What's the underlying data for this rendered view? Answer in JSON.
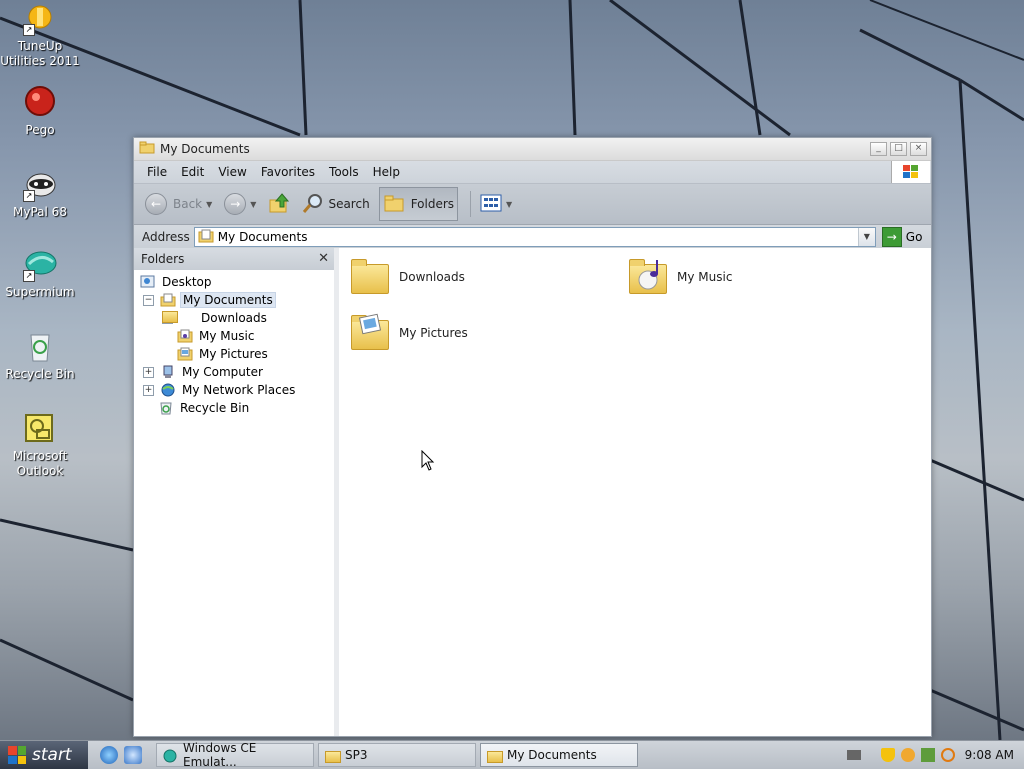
{
  "desktop": {
    "icons": [
      {
        "label": "TuneUp Utilities 2011",
        "icon": "tuneup-icon"
      },
      {
        "label": "Pego",
        "icon": "pego-icon"
      },
      {
        "label": "MyPal 68",
        "icon": "mypal-icon"
      },
      {
        "label": "Supermium",
        "icon": "supermium-icon"
      },
      {
        "label": "Recycle Bin",
        "icon": "recycle-bin-icon"
      },
      {
        "label": "Microsoft Outlook",
        "icon": "outlook-icon"
      }
    ]
  },
  "window": {
    "title": "My Documents",
    "menu": [
      "File",
      "Edit",
      "View",
      "Favorites",
      "Tools",
      "Help"
    ],
    "toolbar": {
      "back": "Back",
      "search": "Search",
      "folders": "Folders"
    },
    "address": {
      "label": "Address",
      "value": "My Documents",
      "go": "Go"
    },
    "folders_pane": {
      "title": "Folders",
      "tree": [
        {
          "label": "Desktop"
        },
        {
          "label": "My Documents"
        },
        {
          "label": "Downloads"
        },
        {
          "label": "My Music"
        },
        {
          "label": "My Pictures"
        },
        {
          "label": "My Computer"
        },
        {
          "label": "My Network Places"
        },
        {
          "label": "Recycle Bin"
        }
      ]
    },
    "items": [
      {
        "label": "Downloads"
      },
      {
        "label": "My Music"
      },
      {
        "label": "My Pictures"
      }
    ]
  },
  "taskbar": {
    "start": "start",
    "tasks": [
      "Windows CE Emulat...",
      "SP3",
      "My Documents"
    ],
    "clock": "9:08 AM"
  },
  "colors": {
    "accent": "#2e3644",
    "folder_yellow": "#f0d16d",
    "selection": "#dde6f2"
  }
}
